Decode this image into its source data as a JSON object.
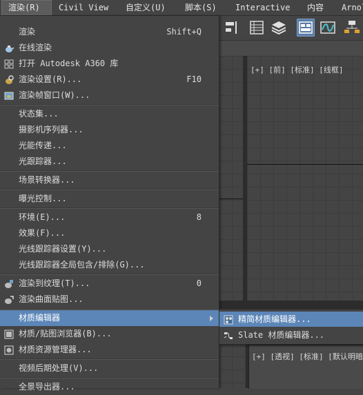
{
  "menubar": {
    "items": [
      {
        "label": "渲染(R)"
      },
      {
        "label": "Civil View"
      },
      {
        "label": "自定义(U)"
      },
      {
        "label": "脚本(S)"
      },
      {
        "label": "Interactive"
      },
      {
        "label": "内容"
      },
      {
        "label": "Arnold"
      }
    ]
  },
  "viewports": {
    "top_label": "[+] [前] [标准] [线框]",
    "bottom_label": "[+] [透视] [标准] [默认明暗处理"
  },
  "render_menu": {
    "items": [
      {
        "label": "渲染",
        "shortcut": "Shift+Q",
        "icon": ""
      },
      {
        "label": "在线渲染",
        "shortcut": "",
        "icon": "teapot-cloud-icon"
      },
      {
        "label": "打开 Autodesk A360 库",
        "shortcut": "",
        "icon": "a360-gallery-icon"
      },
      {
        "label": "渲染设置(R)...",
        "shortcut": "F10",
        "icon": "render-setup-icon"
      },
      {
        "label": "渲染帧窗口(W)...",
        "shortcut": "",
        "icon": "frame-window-icon"
      },
      {
        "label": "状态集...",
        "shortcut": "",
        "icon": ""
      },
      {
        "label": "摄影机序列器...",
        "shortcut": "",
        "icon": ""
      },
      {
        "label": "光能传递...",
        "shortcut": "",
        "icon": ""
      },
      {
        "label": "光跟踪器...",
        "shortcut": "",
        "icon": ""
      },
      {
        "label": "场景转换器...",
        "shortcut": "",
        "icon": ""
      },
      {
        "label": "曝光控制...",
        "shortcut": "",
        "icon": ""
      },
      {
        "label": "环境(E)...",
        "shortcut": "8",
        "icon": ""
      },
      {
        "label": "效果(F)...",
        "shortcut": "",
        "icon": ""
      },
      {
        "label": "光线跟踪器设置(Y)...",
        "shortcut": "",
        "icon": ""
      },
      {
        "label": "光线跟踪器全局包含/排除(G)...",
        "shortcut": "",
        "icon": ""
      },
      {
        "label": "渲染到纹理(T)...",
        "shortcut": "0",
        "icon": "render-to-texture-icon"
      },
      {
        "label": "渲染曲面贴图...",
        "shortcut": "",
        "icon": "surface-map-icon"
      },
      {
        "label": "材质编辑器",
        "shortcut": "",
        "icon": ""
      },
      {
        "label": "材质/贴图浏览器(B)...",
        "shortcut": "",
        "icon": "material-browser-icon"
      },
      {
        "label": "材质资源管理器...",
        "shortcut": "",
        "icon": "material-explorer-icon"
      },
      {
        "label": "视频后期处理(V)...",
        "shortcut": "",
        "icon": ""
      },
      {
        "label": "全景导出器...",
        "shortcut": "",
        "icon": ""
      }
    ]
  },
  "material_editor_submenu": {
    "items": [
      {
        "label": "精简材质编辑器...",
        "icon": "compact-material-editor-icon"
      },
      {
        "label": "Slate 材质编辑器...",
        "icon": "slate-material-editor-icon"
      }
    ]
  },
  "colors": {
    "highlight": "#5c86b8",
    "menu_bg": "#444444"
  }
}
